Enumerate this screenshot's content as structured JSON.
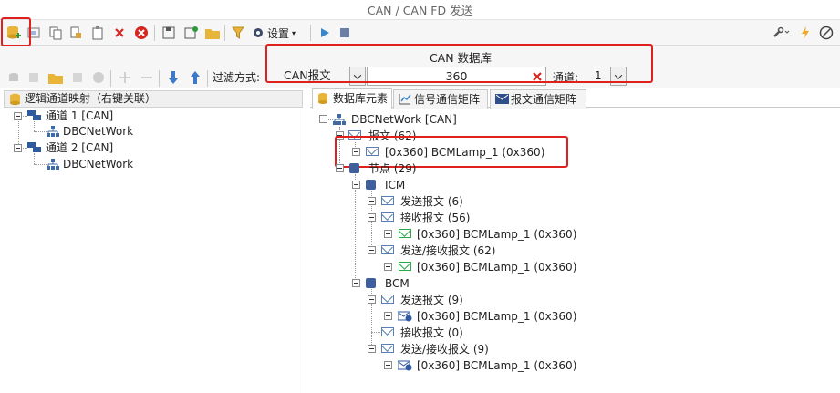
{
  "window": {
    "title": "CAN / CAN FD 发送"
  },
  "toolbar": {
    "settings_label": "设置"
  },
  "filter": {
    "db_title": "CAN 数据库",
    "filter_label": "过滤方式:",
    "filter_value": "CAN报文",
    "search_value": "360",
    "channel_label": "通道:",
    "channel_value": "1"
  },
  "left": {
    "header": "逻辑通道映射（右键关联）",
    "channels": [
      {
        "label": "通道 1 [CAN]",
        "child": "DBCNetWork"
      },
      {
        "label": "通道 2 [CAN]",
        "child": "DBCNetWork"
      }
    ]
  },
  "tabs": [
    "数据库元素",
    "信号通信矩阵",
    "报文通信矩阵"
  ],
  "tree": {
    "root": "DBCNetWork [CAN]",
    "messages": "报文 (62)",
    "msg_item": "[0x360] BCMLamp_1 (0x360)",
    "nodes": "节点 (29)",
    "icm": {
      "name": "ICM",
      "send": "发送报文 (6)",
      "recv": "接收报文 (56)",
      "recv_item": "[0x360] BCMLamp_1 (0x360)",
      "sendrecv": "发送/接收报文 (62)",
      "sendrecv_item": "[0x360] BCMLamp_1 (0x360)"
    },
    "bcm": {
      "name": "BCM",
      "send": "发送报文 (9)",
      "send_item": "[0x360] BCMLamp_1 (0x360)",
      "recv": "接收报文 (0)",
      "sendrecv": "发送/接收报文 (9)",
      "sendrecv_item": "[0x360] BCMLamp_1 (0x360)"
    }
  }
}
